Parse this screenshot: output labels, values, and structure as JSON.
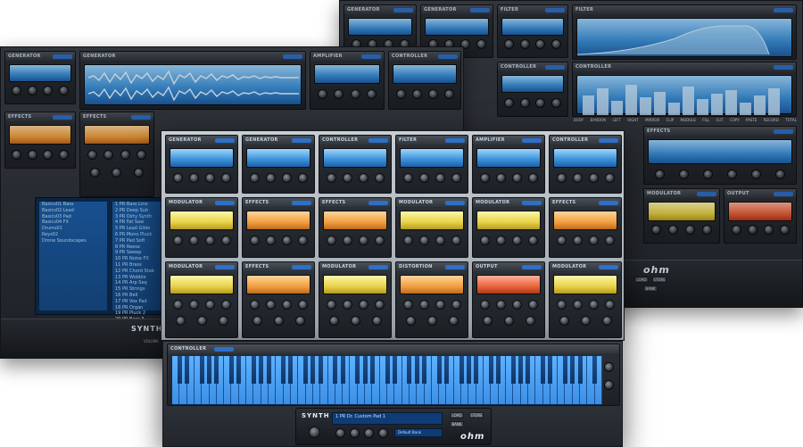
{
  "modules": {
    "generator": "GENERATOR",
    "amplifier": "AMPLIFIER",
    "filter": "FILTER",
    "controller": "CONTROLLER",
    "effects": "EFFECTS",
    "modulator": "MODULATOR",
    "distortion": "DISTORTION",
    "output": "OUTPUT",
    "keyboard": "CONTROLLER"
  },
  "browser": {
    "left": [
      "Basics01 Bass",
      "Basics02 Lead",
      "Basics03 Pad",
      "Basics04 FX",
      "Drums01",
      "Keys02",
      "Drone Soundscapes"
    ],
    "right": [
      "1 PR Bass Line",
      "2 PR Deep Sub",
      "3 PR Dirty Synth",
      "4 PR Fat Saw",
      "5 PR Lead Glide",
      "6 PR Mono Pluck",
      "7 PR Pad Soft",
      "8 PR Reese",
      "9 PR Sweep",
      "10 PR Noise FX",
      "11 PR Brass",
      "12 PR Chord Stab",
      "13 PR Wobble",
      "14 PR Arp Seq",
      "15 PR Strings",
      "16 PR Bell",
      "17 PR Vox Pad",
      "18 PR Organ",
      "19 PR Pluck 2",
      "20 PR Bass 3"
    ]
  },
  "bottom": {
    "logo": "SYNTH",
    "patch": "1 PR Dr. Custom Pad 1",
    "patch2": "Default Bank",
    "btn_load": "LOAD",
    "btn_store": "STORE",
    "btn_bank": "BANK",
    "brand": "ohm",
    "volume": "VOLUME"
  },
  "back_right": {
    "buttons": [
      "BODY",
      "BANDON",
      "LEFT",
      "RIGHT",
      "MIRROR",
      "CLIP",
      "MODULE",
      "FILL",
      "CUT",
      "COPY",
      "PASTE",
      "RECORD",
      "TOTAL"
    ],
    "load": "LOAD",
    "store": "STORE",
    "bank": "BANK",
    "brand": "ohm"
  },
  "colors": {
    "accent": "#2f6fc7",
    "display_blue": "#3a8fd8",
    "display_yellow": "#e8d24a",
    "display_orange": "#f0a040",
    "display_red": "#e8643c"
  }
}
